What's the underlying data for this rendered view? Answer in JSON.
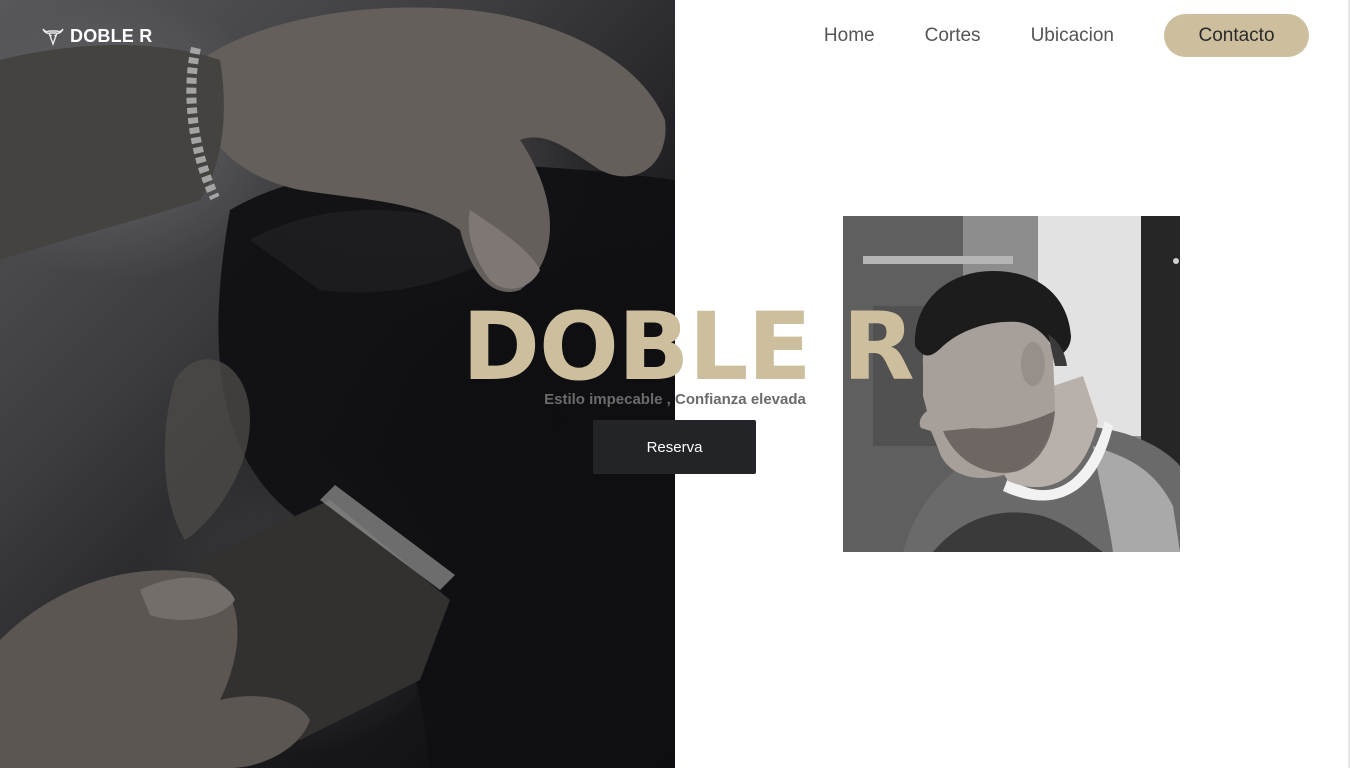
{
  "brand": {
    "name": "DOBLE R",
    "logo_icon": "bull-skull-icon"
  },
  "nav": {
    "links": [
      "Home",
      "Cortes",
      "Ubicacion"
    ],
    "contact_label": "Contacto"
  },
  "hero": {
    "title": "DOBLE R",
    "subtitle": "Estilo impecable , Confianza elevada",
    "cta_label": "Reserva"
  },
  "colors": {
    "accent": "#cdbf9e",
    "button_dark": "#222427",
    "nav_text": "#555555"
  }
}
